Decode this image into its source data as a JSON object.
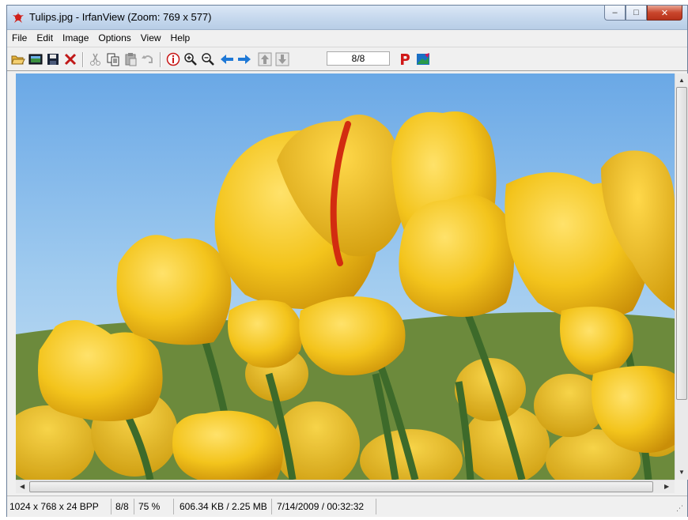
{
  "window": {
    "title": "Tulips.jpg - IrfanView (Zoom: 769 x 577)",
    "buttons": {
      "minimize": "–",
      "maximize": "□",
      "close": "✕"
    }
  },
  "menu": [
    "File",
    "Edit",
    "Image",
    "Options",
    "View",
    "Help"
  ],
  "toolbar": {
    "page_indicator": "8/8",
    "icons": [
      "open-folder-icon",
      "slideshow-icon",
      "save-icon",
      "delete-icon",
      "cut-icon",
      "copy-icon",
      "paste-icon",
      "undo-icon",
      "info-icon",
      "zoom-in-icon",
      "zoom-out-icon",
      "previous-icon",
      "next-icon",
      "first-page-icon",
      "last-page-icon",
      "print-icon",
      "paint-icon"
    ]
  },
  "image": {
    "subject": "Tulips.jpg"
  },
  "status": {
    "dimensions": "1024 x 768 x 24 BPP",
    "page": "8/8",
    "zoom": "75 %",
    "size": "606.34 KB / 2.25 MB",
    "datetime": "7/14/2009 / 00:32:32"
  },
  "colors": {
    "sky": "#8dbbe6",
    "tulip": "#f2c21a",
    "stem": "#3f6a2c",
    "accent_red": "#d22c10"
  }
}
